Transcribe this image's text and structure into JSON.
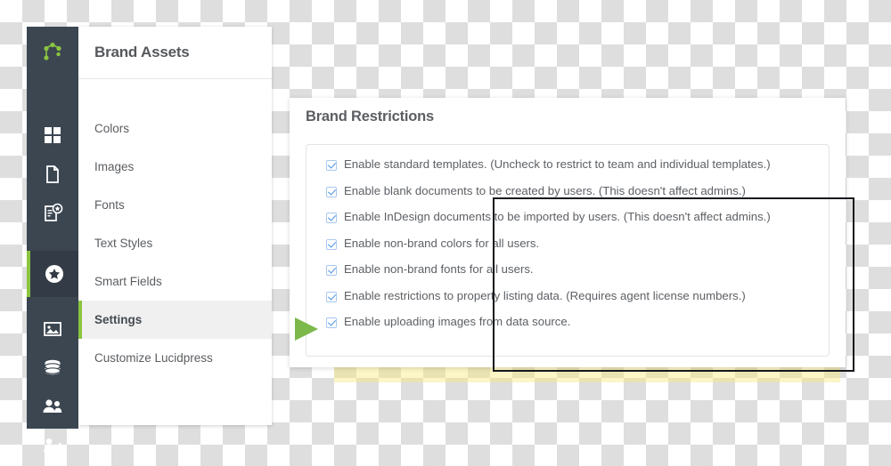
{
  "app": {
    "logo_icon": "lucidpress-logo-icon",
    "accent_color": "#8bc53f",
    "rail_color": "#3b4651"
  },
  "icon_rail": {
    "items": [
      {
        "icon": "grid-icon",
        "name": "documents-grid",
        "active": false
      },
      {
        "icon": "page-icon",
        "name": "templates",
        "active": false
      },
      {
        "icon": "page-star-icon",
        "name": "brand-templates",
        "active": false
      },
      {
        "icon": "star-circle-icon",
        "name": "brand-assets",
        "active": true
      },
      {
        "icon": "image-icon",
        "name": "media",
        "active": false
      },
      {
        "icon": "database-icon",
        "name": "data",
        "active": false
      },
      {
        "icon": "users-icon",
        "name": "users",
        "active": false
      },
      {
        "icon": "user-edit-icon",
        "name": "account",
        "active": false
      }
    ]
  },
  "nav_panel": {
    "title": "Brand Assets",
    "items": [
      {
        "label": "Colors",
        "active": false
      },
      {
        "label": "Images",
        "active": false
      },
      {
        "label": "Fonts",
        "active": false
      },
      {
        "label": "Text Styles",
        "active": false
      },
      {
        "label": "Smart Fields",
        "active": false
      },
      {
        "label": "Settings",
        "active": true
      },
      {
        "label": "Customize Lucidpress",
        "active": false
      }
    ]
  },
  "content": {
    "title": "Brand Restrictions",
    "checkboxes": [
      {
        "label": "Enable standard templates. (Uncheck to restrict to team and individual templates.)",
        "checked": true
      },
      {
        "label": "Enable blank documents to be created by users. (This doesn't affect admins.)",
        "checked": true
      },
      {
        "label": "Enable InDesign documents to be imported by users. (This doesn't affect admins.)",
        "checked": true
      },
      {
        "label": "Enable non-brand colors for all users.",
        "checked": true
      },
      {
        "label": "Enable non-brand fonts for all users.",
        "checked": true
      },
      {
        "label": "Enable restrictions to property listing data. (Requires agent license numbers.)",
        "checked": true
      },
      {
        "label": "Enable uploading images from data source.",
        "checked": true
      }
    ]
  },
  "annotations": {
    "arrow": {
      "name": "green-pointer-arrow",
      "color": "#7cb94a"
    },
    "highlight": {
      "name": "yellow-highlight-band",
      "color": "#f7e978"
    },
    "outline": {
      "name": "black-outline-box",
      "color": "#14181c"
    }
  }
}
